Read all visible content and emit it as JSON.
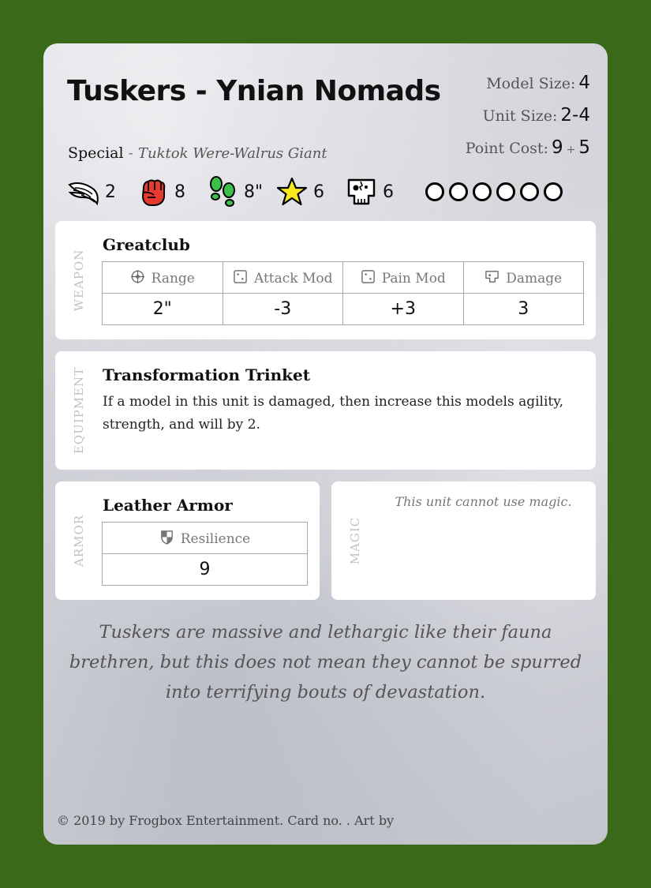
{
  "card": {
    "title": "Tuskers - Ynian Nomads",
    "stats": [
      {
        "label": "Model Size:",
        "value": "4"
      },
      {
        "label": "Unit Size:",
        "value": "2-4"
      },
      {
        "label": "Point Cost:",
        "value": "9",
        "plus": "+",
        "extra": "5"
      }
    ],
    "special": {
      "label": "Special",
      "dash": " - ",
      "value": "Tuktok Were-Walrus Giant"
    },
    "attributes": [
      {
        "icon": "wing-icon",
        "value": "2"
      },
      {
        "icon": "fist-icon",
        "value": "8"
      },
      {
        "icon": "footprints-icon",
        "value": "8\""
      },
      {
        "icon": "star-icon",
        "value": "6"
      },
      {
        "icon": "skull-icon",
        "value": "6"
      }
    ],
    "wound_track_count": 6,
    "weapon": {
      "section_label": "WEAPON",
      "name": "Greatclub",
      "headers": [
        {
          "icon": "crosshair-icon",
          "label": "Range"
        },
        {
          "icon": "die-icon",
          "label": "Attack Mod"
        },
        {
          "icon": "die-icon",
          "label": "Pain Mod"
        },
        {
          "icon": "damage-icon",
          "label": "Damage"
        }
      ],
      "values": [
        "2\"",
        "-3",
        "+3",
        "3"
      ]
    },
    "equipment": {
      "section_label": "EQUIPMENT",
      "name": "Transformation Trinket",
      "description": "If a model in this unit is damaged, then increase this models agility, strength, and will by 2."
    },
    "armor": {
      "section_label": "ARMOR",
      "name": "Leather Armor",
      "header": {
        "icon": "shield-icon",
        "label": "Resilience"
      },
      "value": "9"
    },
    "magic": {
      "section_label": "MAGIC",
      "text": "This unit cannot use magic."
    },
    "flavor": "Tuskers are massive and lethargic like their fauna brethren, but this does not mean they cannot be spurred into terrifying bouts of devastation.",
    "footer": "© 2019 by Frogbox Entertainment. Card no. . Art by"
  }
}
